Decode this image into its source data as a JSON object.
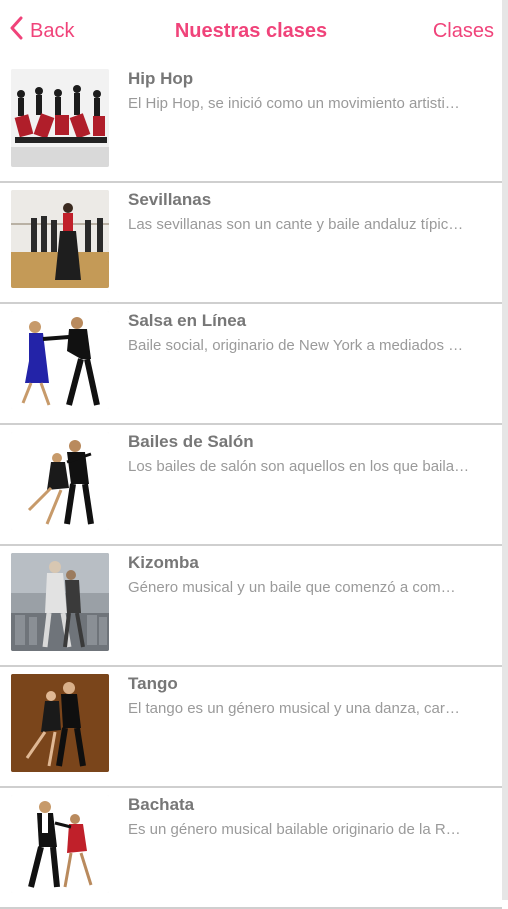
{
  "nav": {
    "back_label": "Back",
    "title": "Nuestras clases",
    "right_label": "Clases",
    "accent_color": "#f0437a"
  },
  "classes": [
    {
      "name": "Hip Hop",
      "description": "El Hip Hop, se inició como un movimiento artisti…",
      "thumb": "hip-hop-thumbnail"
    },
    {
      "name": "Sevillanas",
      "description": "Las sevillanas son un cante y baile andaluz típic…",
      "thumb": "sevillanas-thumbnail"
    },
    {
      "name": "Salsa en Línea",
      "description": "Baile social, originario de New York a mediados …",
      "thumb": "salsa-thumbnail"
    },
    {
      "name": "Bailes de Salón",
      "description": "Los bailes de salón son aquellos en los que baila…",
      "thumb": "ballroom-thumbnail"
    },
    {
      "name": "Kizomba",
      "description": "Género musical y un baile que comenzó a com…",
      "thumb": "kizomba-thumbnail"
    },
    {
      "name": "Tango",
      "description": "El tango es un género musical y una danza, car…",
      "thumb": "tango-thumbnail"
    },
    {
      "name": "Bachata",
      "description": "Es un género musical bailable originario de la R…",
      "thumb": "bachata-thumbnail"
    }
  ]
}
